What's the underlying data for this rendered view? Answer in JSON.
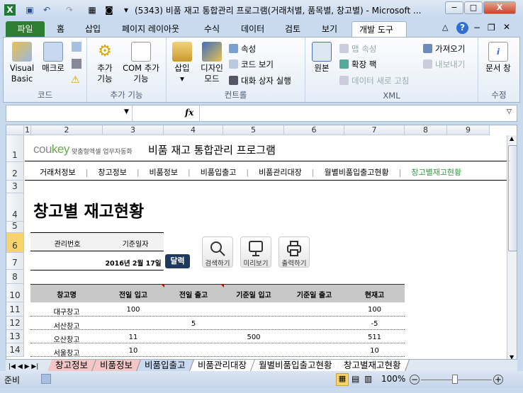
{
  "window": {
    "title": "(5343) 비품 재고 통합관리 프로그램(거래처별, 품목별, 창고별)  -  Microsoft ...",
    "controls": [
      "minimize",
      "maximize",
      "close"
    ]
  },
  "ribbon_tabs": [
    "파일",
    "홈",
    "삽입",
    "페이지 레이아웃",
    "수식",
    "데이터",
    "검토",
    "보기",
    "개발 도구"
  ],
  "active_tab": "개발 도구",
  "ribbon": {
    "code": {
      "label": "코드",
      "visual_basic": "Visual Basic",
      "macro": "매크로"
    },
    "addins": {
      "label": "추가 기능",
      "addin": "추가 기능",
      "com": "COM 추가 기능"
    },
    "controls": {
      "label": "컨트롤",
      "insert": "삽입",
      "design": "디자인 모드",
      "properties": "속성",
      "view_code": "코드 보기",
      "run_dialog": "대화 상자 실행"
    },
    "xml": {
      "label": "XML",
      "source": "원본",
      "map_props": "맵 속성",
      "expansion": "확장 팩",
      "refresh": "데이터 새로 고침",
      "import": "가져오기",
      "export": "내보내기"
    },
    "modify": {
      "label": "수정",
      "doc_panel": "문서 창"
    }
  },
  "formula_bar": {
    "name_box": "",
    "fx": "fx",
    "value": ""
  },
  "columns": [
    "1",
    "2",
    "3",
    "4",
    "5",
    "6",
    "7",
    "8",
    "9"
  ],
  "rows": [
    "1",
    "2",
    "3",
    "4",
    "5",
    "6",
    "7",
    "8",
    "10",
    "11",
    "12",
    "13",
    "14"
  ],
  "sheet": {
    "brand": "coukey",
    "brand_sub": "맞춤형엑셀 업무자동화",
    "app_title": "비품 재고 통합관리 프로그램",
    "nav": [
      "거래처정보",
      "창고정보",
      "비품정보",
      "비품입출고",
      "비품관리대장",
      "월별비품입출고현황",
      "창고별재고현황"
    ],
    "nav_active": "창고별재고현황",
    "page_title": "창고별 재고현황",
    "info_headers": [
      "관리번호",
      "기준일자"
    ],
    "info_date": "2016년 2월 17일",
    "calendar_button": "달력",
    "buttons": [
      "검색하기",
      "미리보기",
      "출력하기"
    ],
    "table": {
      "headers": [
        "창고명",
        "전일 입고",
        "전일 출고",
        "기준일 입고",
        "기준일 출고",
        "현재고"
      ],
      "rows": [
        [
          "대구창고",
          "100",
          "",
          "",
          "",
          "100"
        ],
        [
          "서산창고",
          "",
          "5",
          "",
          "",
          "-5"
        ],
        [
          "오산창고",
          "11",
          "",
          "500",
          "",
          "511"
        ],
        [
          "서울창고",
          "10",
          "",
          "",
          "",
          "10"
        ]
      ]
    }
  },
  "sheet_tabs": [
    "창고정보",
    "비품정보",
    "비품입출고",
    "비품관리대장",
    "월별비품입출고현황",
    "창고별재고현황"
  ],
  "active_sheet": "창고별재고현황",
  "status": {
    "ready": "준비",
    "zoom": "100%"
  },
  "colors": {
    "accent_green": "#2e9e3e",
    "file_tab": "#2d7d32",
    "calendar_btn": "#1f3a5f",
    "header_bg": "#c8c8c8"
  }
}
